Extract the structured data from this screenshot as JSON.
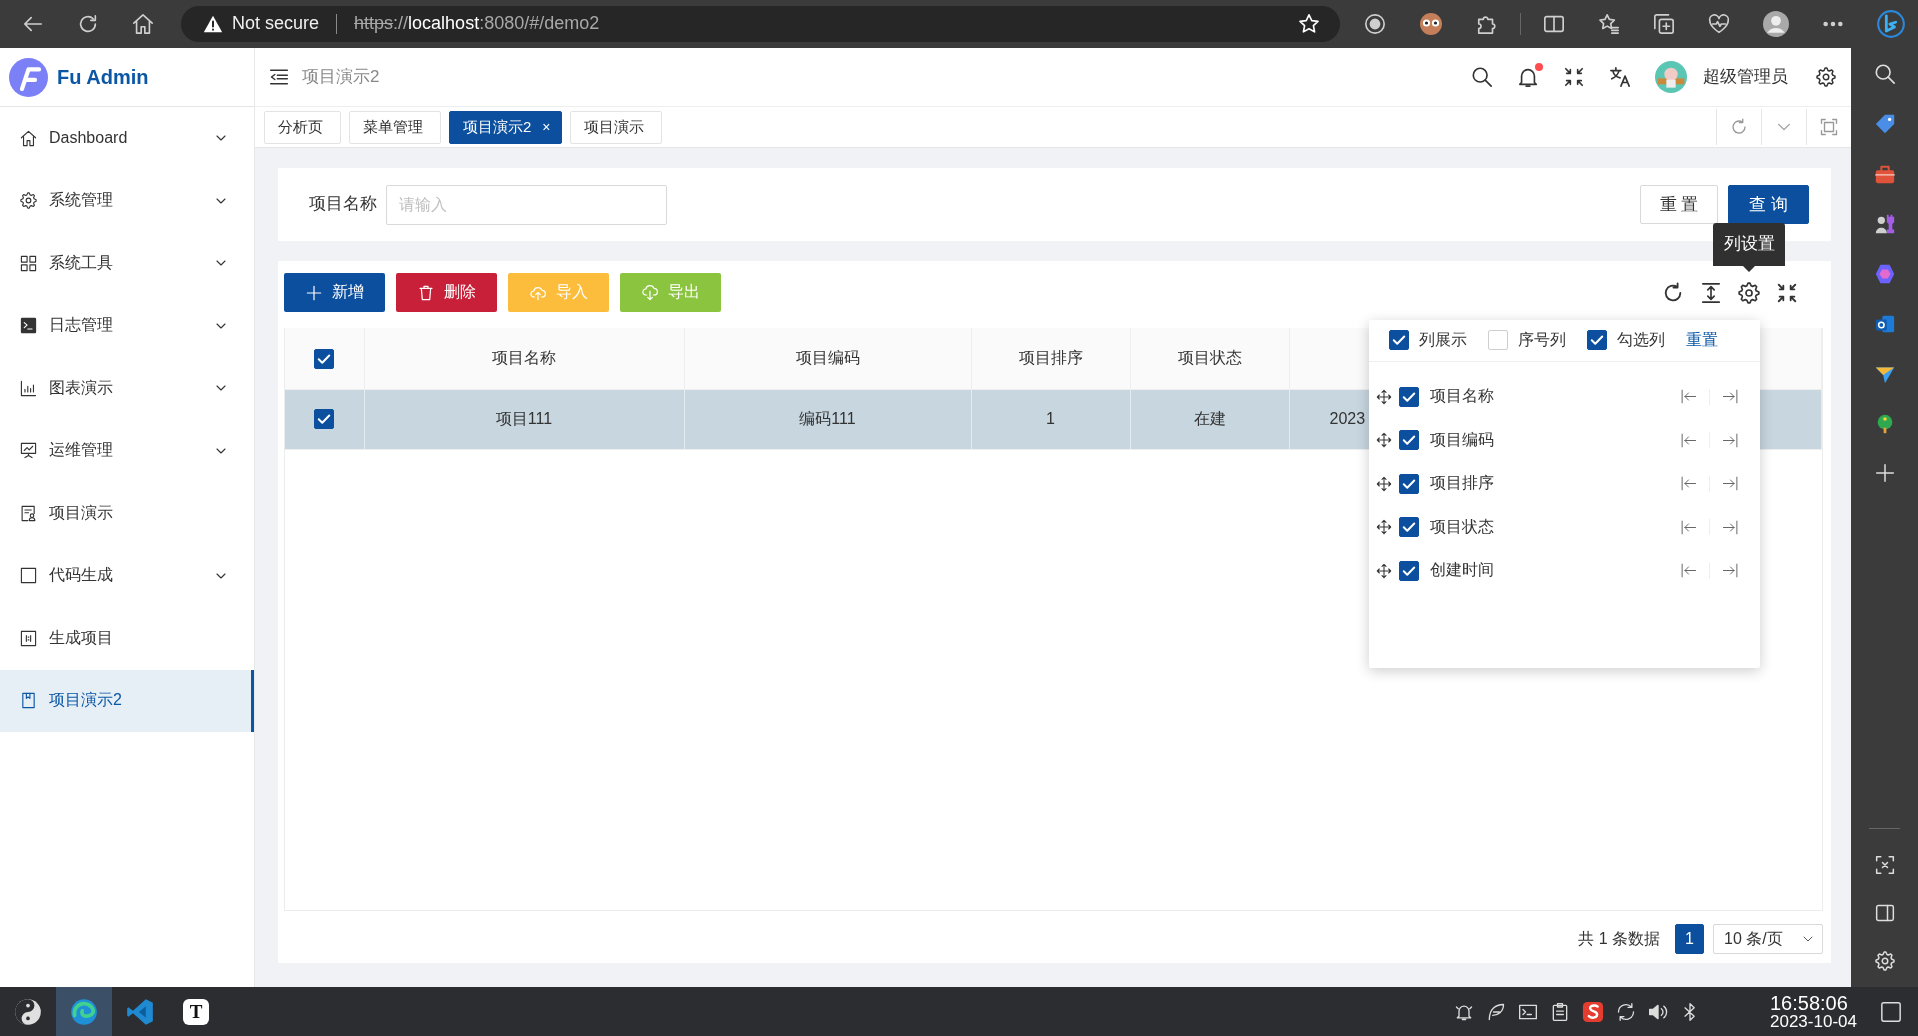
{
  "browser": {
    "security": "Not secure",
    "url_parts": [
      {
        "text": "https",
        "kind": "scheme"
      },
      {
        "text": "://",
        "kind": "dim"
      },
      {
        "text": "localhost",
        "kind": "host"
      },
      {
        "text": ":8080/#/demo2",
        "kind": "dim"
      }
    ]
  },
  "app": {
    "brand": "Fu Admin",
    "breadcrumb": "项目演示2",
    "notification_dot": true,
    "user_name": "超级管理员"
  },
  "sidebar": {
    "items": [
      {
        "label": "Dashboard",
        "has_submenu": true,
        "selected": false
      },
      {
        "label": "系统管理",
        "has_submenu": true,
        "selected": false
      },
      {
        "label": "系统工具",
        "has_submenu": true,
        "selected": false
      },
      {
        "label": "日志管理",
        "has_submenu": true,
        "selected": false
      },
      {
        "label": "图表演示",
        "has_submenu": true,
        "selected": false
      },
      {
        "label": "运维管理",
        "has_submenu": true,
        "selected": false
      },
      {
        "label": "项目演示",
        "has_submenu": false,
        "selected": false
      },
      {
        "label": "代码生成",
        "has_submenu": true,
        "selected": false
      },
      {
        "label": "生成项目",
        "has_submenu": false,
        "selected": false
      },
      {
        "label": "项目演示2",
        "has_submenu": false,
        "selected": true
      }
    ]
  },
  "tabs": [
    {
      "label": "分析页",
      "selected": false
    },
    {
      "label": "菜单管理",
      "selected": false
    },
    {
      "label": "项目演示2",
      "selected": true,
      "close": "×"
    },
    {
      "label": "项目演示",
      "selected": false
    }
  ],
  "search_form": {
    "fields": [
      {
        "label": "项目名称",
        "placeholder": "请输入"
      }
    ],
    "buttons": [
      {
        "label": "重 置",
        "kind": "reset"
      },
      {
        "label": "查 询",
        "kind": "submit"
      }
    ]
  },
  "toolbar": {
    "buttons": [
      {
        "label": "新增",
        "kind": "add"
      },
      {
        "label": "删除",
        "kind": "delete"
      },
      {
        "label": "导入",
        "kind": "import"
      },
      {
        "label": "导出",
        "kind": "export"
      }
    ],
    "tooltip": "列设置"
  },
  "table": {
    "select_all": true,
    "columns": [
      "项目名称",
      "项目编码",
      "项目排序",
      "项目状态"
    ],
    "rows": [
      {
        "selected": true,
        "cells": [
          "项目111",
          "编码111",
          "1",
          "在建",
          "2023"
        ]
      }
    ]
  },
  "column_settings": {
    "options": [
      {
        "label": "列展示",
        "checked": true
      },
      {
        "label": "序号列",
        "checked": false
      },
      {
        "label": "勾选列",
        "checked": true
      }
    ],
    "reset": "重置",
    "columns": [
      {
        "label": "项目名称",
        "checked": true
      },
      {
        "label": "项目编码",
        "checked": true
      },
      {
        "label": "项目排序",
        "checked": true
      },
      {
        "label": "项目状态",
        "checked": true
      },
      {
        "label": "创建时间",
        "checked": true
      }
    ]
  },
  "pagination": {
    "total": "共 1 条数据",
    "pages": [
      {
        "label": "1",
        "selected": true
      }
    ],
    "page_size": "10 条/页"
  },
  "taskbar": {
    "apps": [
      {
        "selected": false
      },
      {
        "selected": true
      },
      {
        "selected": false
      },
      {
        "selected": false,
        "letter": "T"
      }
    ],
    "time": "16:58:06",
    "date": "2023-10-04"
  }
}
